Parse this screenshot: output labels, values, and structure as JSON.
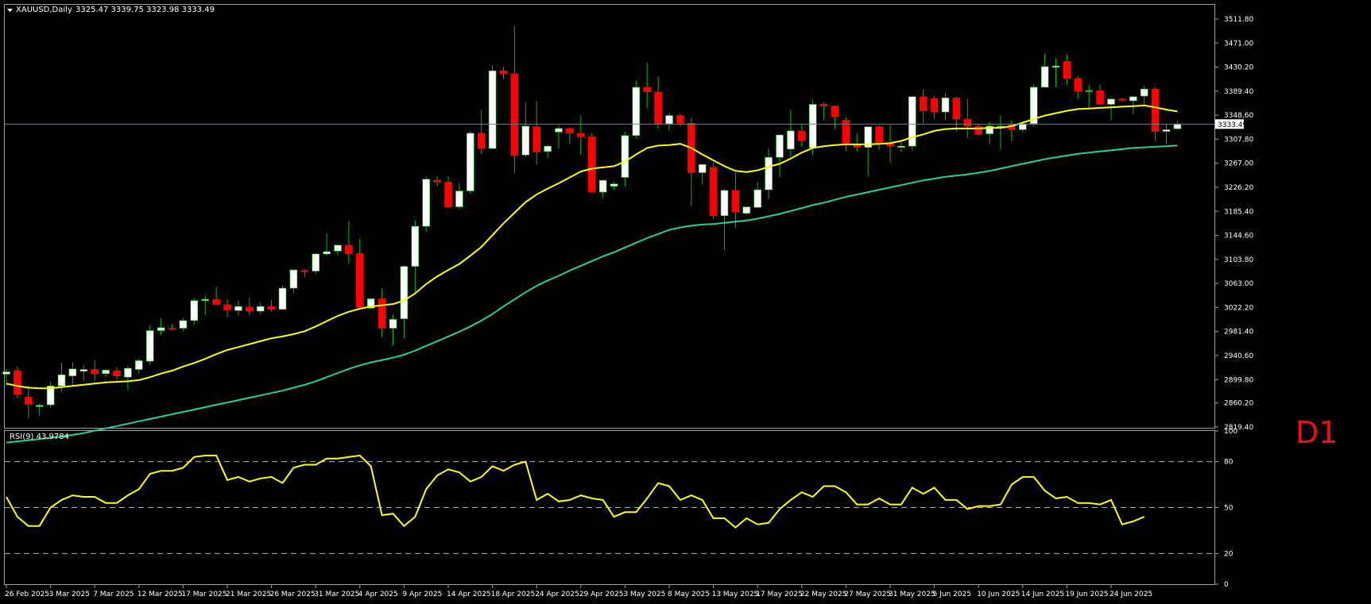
{
  "chart_title": "XAUUSD,Daily",
  "ohlc_header": "3325.47 3339.75 3323.98 3333.49",
  "timeframe_badge": "D1",
  "price_tag": "3333.49",
  "colors": {
    "background": "#000000",
    "bull_body": "#ffffff",
    "bear_body": "#ff0000",
    "wick": "#00c000",
    "ma_fast": "#ffff00",
    "ma_slow": "#20d0a0",
    "rsi_line": "#ffff00",
    "bid_line": "#708090",
    "frame": "#9aa0a6"
  },
  "chart_data": [
    {
      "type": "candlestick",
      "title": "XAUUSD,Daily",
      "y_ticks": [
        2819.4,
        2860.2,
        2899.8,
        2940.6,
        2981.4,
        3022.2,
        3063.0,
        3103.8,
        3144.6,
        3185.4,
        3226.2,
        3267.0,
        3307.8,
        3348.6,
        3389.4,
        3430.2,
        3471.0,
        3511.8
      ],
      "ylim": [
        2818,
        3536
      ],
      "x_ticks": [
        "26 Feb 2025",
        "3 Mar 2025",
        "7 Mar 2025",
        "12 Mar 2025",
        "17 Mar 2025",
        "21 Mar 2025",
        "26 Mar 2025",
        "31 Mar 2025",
        "4 Apr 2025",
        "9 Apr 2025",
        "14 Apr 2025",
        "18 Apr 2025",
        "24 Apr 2025",
        "29 Apr 2025",
        "3 May 2025",
        "8 May 2025",
        "13 May 2025",
        "17 May 2025",
        "22 May 2025",
        "27 May 2025",
        "31 May 2025",
        "5 Jun 2025",
        "10 Jun 2025",
        "14 Jun 2025",
        "19 Jun 2025",
        "24 Jun 2025"
      ],
      "x_tick_index": [
        0,
        4,
        8,
        12,
        16,
        20,
        24,
        28,
        32,
        36,
        40,
        44,
        48,
        52,
        56,
        60,
        64,
        68,
        72,
        76,
        80,
        84,
        88,
        92,
        96,
        100
      ],
      "candles": [
        [
          2909,
          2918,
          2890,
          2913
        ],
        [
          2915,
          2922,
          2868,
          2875
        ],
        [
          2870,
          2890,
          2835,
          2858
        ],
        [
          2854,
          2860,
          2838,
          2856
        ],
        [
          2857,
          2896,
          2852,
          2889
        ],
        [
          2889,
          2928,
          2880,
          2908
        ],
        [
          2906,
          2929,
          2890,
          2918
        ],
        [
          2914,
          2925,
          2897,
          2917
        ],
        [
          2917,
          2933,
          2898,
          2910
        ],
        [
          2910,
          2918,
          2904,
          2916
        ],
        [
          2915,
          2921,
          2900,
          2906
        ],
        [
          2904,
          2923,
          2883,
          2919
        ],
        [
          2917,
          2935,
          2910,
          2932
        ],
        [
          2931,
          2992,
          2925,
          2983
        ],
        [
          2983,
          3004,
          2975,
          2988
        ],
        [
          2987,
          2994,
          2983,
          2986
        ],
        [
          2987,
          3004,
          2982,
          3000
        ],
        [
          3000,
          3038,
          2993,
          3034
        ],
        [
          3034,
          3043,
          3010,
          3036
        ],
        [
          3036,
          3057,
          3028,
          3027
        ],
        [
          3027,
          3036,
          3006,
          3018
        ],
        [
          3017,
          3034,
          3009,
          3024
        ],
        [
          3023,
          3039,
          3009,
          3016
        ],
        [
          3016,
          3031,
          3011,
          3024
        ],
        [
          3024,
          3035,
          3015,
          3019
        ],
        [
          3019,
          3060,
          3019,
          3055
        ],
        [
          3055,
          3085,
          3047,
          3086
        ],
        [
          3085,
          3087,
          3074,
          3083
        ],
        [
          3084,
          3115,
          3079,
          3113
        ],
        [
          3113,
          3148,
          3110,
          3117
        ],
        [
          3118,
          3127,
          3111,
          3128
        ],
        [
          3128,
          3169,
          3097,
          3113
        ],
        [
          3114,
          3139,
          3023,
          3022
        ],
        [
          3021,
          3036,
          3020,
          3037
        ],
        [
          3037,
          3055,
          2972,
          2987
        ],
        [
          2987,
          3010,
          2958,
          3002
        ],
        [
          3003,
          3094,
          2970,
          3092
        ],
        [
          3092,
          3170,
          3045,
          3160
        ],
        [
          3160,
          3245,
          3150,
          3240
        ],
        [
          3238,
          3245,
          3228,
          3235
        ],
        [
          3235,
          3245,
          3192,
          3193
        ],
        [
          3193,
          3233,
          3189,
          3220
        ],
        [
          3220,
          3322,
          3215,
          3318
        ],
        [
          3318,
          3358,
          3283,
          3292
        ],
        [
          3292,
          3433,
          3294,
          3424
        ],
        [
          3424,
          3431,
          3410,
          3419
        ],
        [
          3419,
          3500,
          3250,
          3280
        ],
        [
          3281,
          3370,
          3278,
          3330
        ],
        [
          3329,
          3373,
          3265,
          3286
        ],
        [
          3287,
          3298,
          3277,
          3296
        ],
        [
          3320,
          3331,
          3292,
          3326
        ],
        [
          3326,
          3328,
          3300,
          3318
        ],
        [
          3318,
          3348,
          3281,
          3312
        ],
        [
          3312,
          3318,
          3219,
          3218
        ],
        [
          3218,
          3239,
          3208,
          3238
        ],
        [
          3228,
          3235,
          3222,
          3232
        ],
        [
          3243,
          3320,
          3228,
          3314
        ],
        [
          3314,
          3408,
          3309,
          3396
        ],
        [
          3396,
          3438,
          3360,
          3388
        ],
        [
          3388,
          3414,
          3325,
          3334
        ],
        [
          3334,
          3352,
          3322,
          3348
        ],
        [
          3348,
          3351,
          3330,
          3335
        ],
        [
          3335,
          3344,
          3194,
          3251
        ],
        [
          3251,
          3265,
          3231,
          3265
        ],
        [
          3260,
          3268,
          3172,
          3178
        ],
        [
          3178,
          3223,
          3120,
          3221
        ],
        [
          3221,
          3251,
          3158,
          3184
        ],
        [
          3182,
          3193,
          3181,
          3193
        ],
        [
          3192,
          3235,
          3199,
          3222
        ],
        [
          3222,
          3292,
          3206,
          3277
        ],
        [
          3277,
          3289,
          3244,
          3315
        ],
        [
          3291,
          3357,
          3278,
          3322
        ],
        [
          3322,
          3333,
          3295,
          3305
        ],
        [
          3293,
          3375,
          3281,
          3367
        ],
        [
          3367,
          3370,
          3340,
          3364
        ],
        [
          3364,
          3365,
          3325,
          3346
        ],
        [
          3340,
          3345,
          3288,
          3298
        ],
        [
          3298,
          3318,
          3287,
          3294
        ],
        [
          3294,
          3328,
          3246,
          3329
        ],
        [
          3329,
          3331,
          3290,
          3301
        ],
        [
          3300,
          3333,
          3268,
          3296
        ],
        [
          3294,
          3303,
          3286,
          3296
        ],
        [
          3296,
          3382,
          3289,
          3380
        ],
        [
          3380,
          3392,
          3335,
          3356
        ],
        [
          3377,
          3381,
          3343,
          3354
        ],
        [
          3354,
          3386,
          3340,
          3378
        ],
        [
          3378,
          3380,
          3321,
          3342
        ],
        [
          3342,
          3376,
          3310,
          3330
        ],
        [
          3330,
          3333,
          3313,
          3316
        ],
        [
          3317,
          3338,
          3300,
          3330
        ],
        [
          3330,
          3348,
          3290,
          3330
        ],
        [
          3332,
          3340,
          3304,
          3324
        ],
        [
          3324,
          3335,
          3320,
          3334
        ],
        [
          3334,
          3401,
          3329,
          3396
        ],
        [
          3396,
          3453,
          3397,
          3431
        ],
        [
          3430,
          3445,
          3396,
          3432
        ],
        [
          3440,
          3452,
          3400,
          3411
        ],
        [
          3411,
          3415,
          3376,
          3389
        ],
        [
          3389,
          3400,
          3360,
          3390
        ],
        [
          3390,
          3400,
          3368,
          3367
        ],
        [
          3367,
          3376,
          3340,
          3376
        ],
        [
          3376,
          3378,
          3371,
          3374
        ],
        [
          3373,
          3380,
          3350,
          3380
        ],
        [
          3381,
          3398,
          3365,
          3393
        ],
        [
          3393,
          3396,
          3305,
          3321
        ],
        [
          3321,
          3333,
          3300,
          3324
        ],
        [
          3325.47,
          3339.75,
          3323.98,
          3333.49
        ]
      ],
      "series": [
        {
          "role": "moving-average-fast",
          "values": [
            2893,
            2889,
            2886,
            2885,
            2885,
            2887,
            2889,
            2891,
            2893,
            2895,
            2896,
            2897,
            2899,
            2904,
            2910,
            2915,
            2922,
            2928,
            2935,
            2943,
            2950,
            2955,
            2960,
            2965,
            2970,
            2973,
            2977,
            2982,
            2990,
            2999,
            3008,
            3015,
            3020,
            3024,
            3026,
            3028,
            3034,
            3046,
            3062,
            3075,
            3086,
            3096,
            3110,
            3125,
            3145,
            3165,
            3183,
            3201,
            3214,
            3224,
            3233,
            3243,
            3253,
            3258,
            3260,
            3262,
            3270,
            3282,
            3293,
            3297,
            3298,
            3300,
            3293,
            3282,
            3272,
            3262,
            3254,
            3252,
            3255,
            3261,
            3266,
            3275,
            3285,
            3293,
            3296,
            3298,
            3299,
            3299,
            3299,
            3300,
            3301,
            3305,
            3311,
            3316,
            3322,
            3325,
            3326,
            3326,
            3326,
            3327,
            3327,
            3330,
            3336,
            3342,
            3348,
            3352,
            3356,
            3359,
            3360,
            3361,
            3362,
            3363,
            3364,
            3365,
            3362,
            3358,
            3355
          ]
        },
        {
          "role": "moving-average-slow",
          "values": [
            2793,
            2795,
            2797,
            2799,
            2801,
            2803,
            2806,
            2809,
            2813,
            2817,
            2821,
            2825,
            2829,
            2833,
            2837,
            2841,
            2845,
            2849,
            2853,
            2857,
            2861,
            2865,
            2869,
            2873,
            2877,
            2881,
            2886,
            2891,
            2897,
            2904,
            2911,
            2918,
            2924,
            2929,
            2933,
            2937,
            2942,
            2949,
            2957,
            2965,
            2973,
            2981,
            2990,
            3000,
            3011,
            3024,
            3036,
            3048,
            3059,
            3068,
            3076,
            3085,
            3093,
            3101,
            3109,
            3116,
            3124,
            3132,
            3140,
            3147,
            3154,
            3158,
            3161,
            3163,
            3164,
            3166,
            3168,
            3170,
            3173,
            3177,
            3181,
            3186,
            3191,
            3196,
            3200,
            3205,
            3210,
            3214,
            3218,
            3222,
            3226,
            3230,
            3234,
            3238,
            3241,
            3244,
            3246,
            3248,
            3251,
            3254,
            3258,
            3262,
            3266,
            3270,
            3274,
            3277,
            3280,
            3283,
            3285,
            3287,
            3289,
            3291,
            3293,
            3294,
            3295,
            3296,
            3297
          ]
        }
      ]
    },
    {
      "type": "line",
      "title": "RSI(9) 43.9784",
      "y_ticks": [
        0,
        20,
        50,
        80,
        100
      ],
      "levels": [
        20,
        50,
        80
      ],
      "ylim": [
        0,
        100
      ],
      "series": [
        {
          "name": "RSI(9)",
          "values": [
            57,
            44,
            38,
            38,
            50,
            55,
            58,
            57,
            57,
            53,
            53,
            58,
            62,
            72,
            74,
            74,
            76,
            83,
            84,
            84,
            68,
            70,
            67,
            69,
            70,
            66,
            76,
            78,
            78,
            82,
            82,
            83,
            84,
            77,
            45,
            46,
            38,
            44,
            62,
            71,
            75,
            73,
            67,
            70,
            77,
            74,
            78,
            80,
            55,
            59,
            54,
            55,
            58,
            56,
            55,
            44,
            47,
            47,
            56,
            66,
            64,
            55,
            58,
            55,
            43,
            43,
            37,
            43,
            39,
            40,
            49,
            55,
            60,
            57,
            64,
            64,
            60,
            52,
            52,
            56,
            52,
            52,
            63,
            59,
            63,
            55,
            55,
            49,
            51,
            51,
            52,
            65,
            70,
            70,
            61,
            56,
            57,
            53,
            53,
            52,
            55,
            39,
            41,
            44
          ]
        }
      ]
    }
  ]
}
